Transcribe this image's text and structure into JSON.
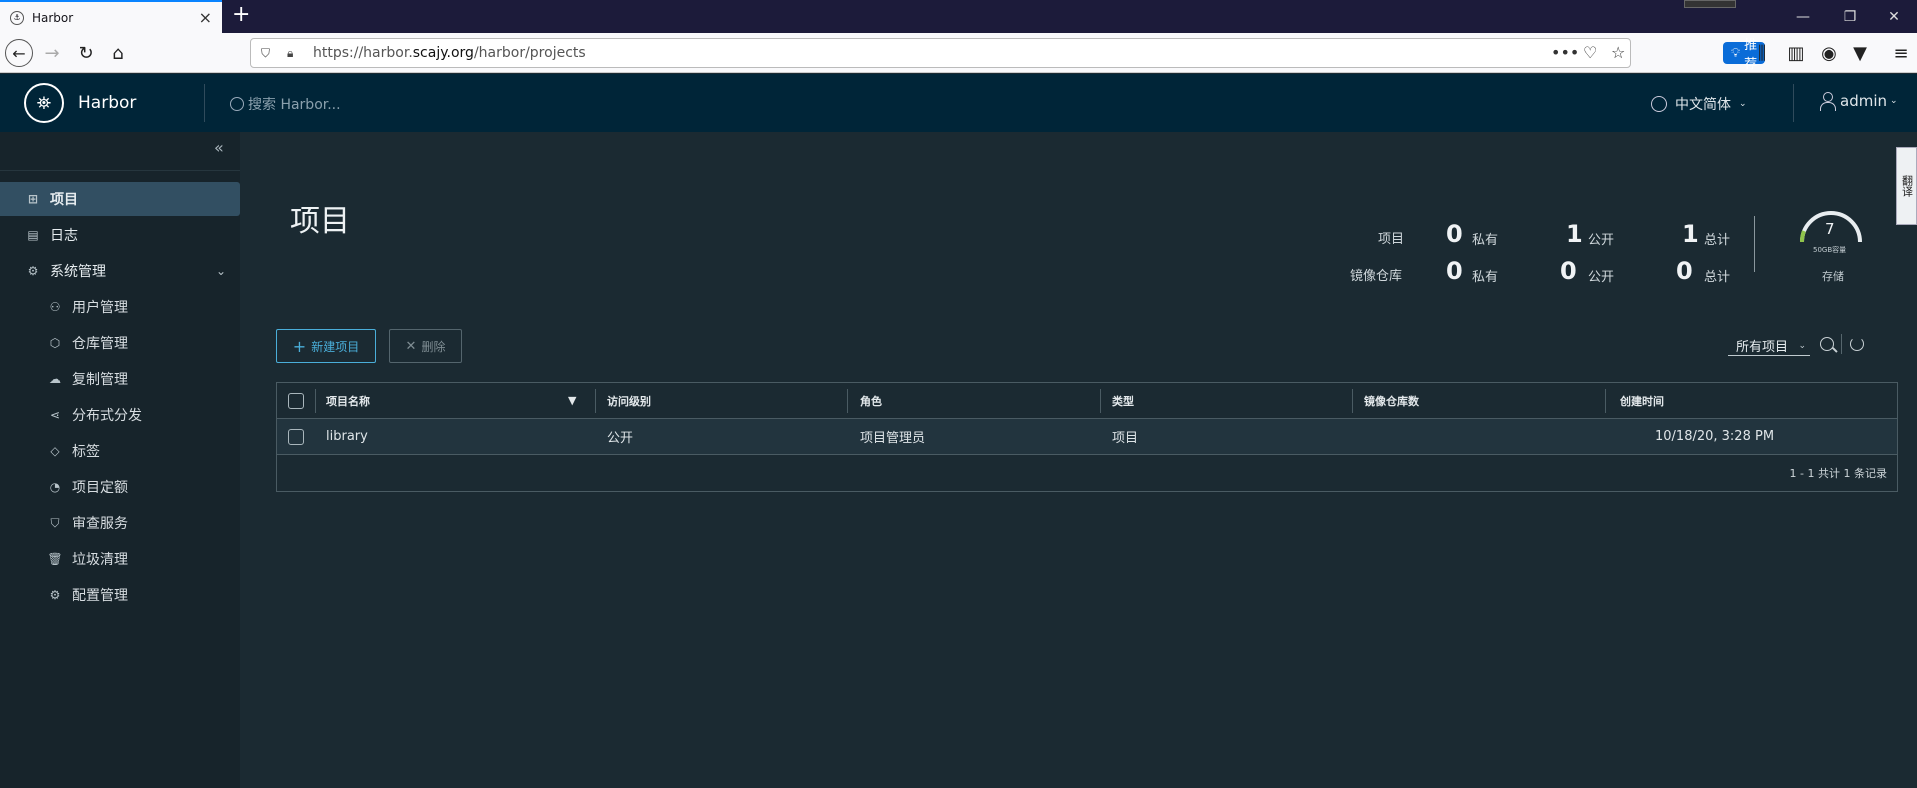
{
  "browser": {
    "tab_title": "Harbor",
    "url_host_prefix": "https://harbor.",
    "url_host_domain": "scajy.org",
    "url_path": "/harbor/projects",
    "recommend_label": "推荐"
  },
  "header": {
    "brand": "Harbor",
    "search_placeholder": "搜索 Harbor...",
    "language": "中文简体",
    "user": "admin"
  },
  "sidebar": {
    "items": [
      {
        "label": "项目"
      },
      {
        "label": "日志"
      },
      {
        "label": "系统管理"
      },
      {
        "label": "用户管理"
      },
      {
        "label": "仓库管理"
      },
      {
        "label": "复制管理"
      },
      {
        "label": "分布式分发"
      },
      {
        "label": "标签"
      },
      {
        "label": "项目定额"
      },
      {
        "label": "审查服务"
      },
      {
        "label": "垃圾清理"
      },
      {
        "label": "配置管理"
      }
    ]
  },
  "page": {
    "title": "项目"
  },
  "stats": {
    "projects_label": "项目",
    "repos_label": "镜像仓库",
    "private_label": "私有",
    "public_label": "公开",
    "total_label": "总计",
    "projects": {
      "private": "0",
      "public": "1",
      "total": "1"
    },
    "repos": {
      "private": "0",
      "public": "0",
      "total": "0"
    },
    "storage": {
      "value": "7",
      "capacity": "50GB容量",
      "label": "存储"
    }
  },
  "toolbar": {
    "new_project": "新建项目",
    "delete": "删除",
    "filter": "所有项目"
  },
  "table": {
    "columns": [
      "项目名称",
      "访问级别",
      "角色",
      "类型",
      "镜像仓库数",
      "创建时间"
    ],
    "rows": [
      {
        "name": "library",
        "access": "公开",
        "role": "项目管理员",
        "type": "项目",
        "repo_count": "",
        "created": "10/18/20, 3:28 PM"
      }
    ],
    "footer": "1 - 1 共计 1 条记录"
  },
  "right_tab": {
    "label": "翻译"
  }
}
